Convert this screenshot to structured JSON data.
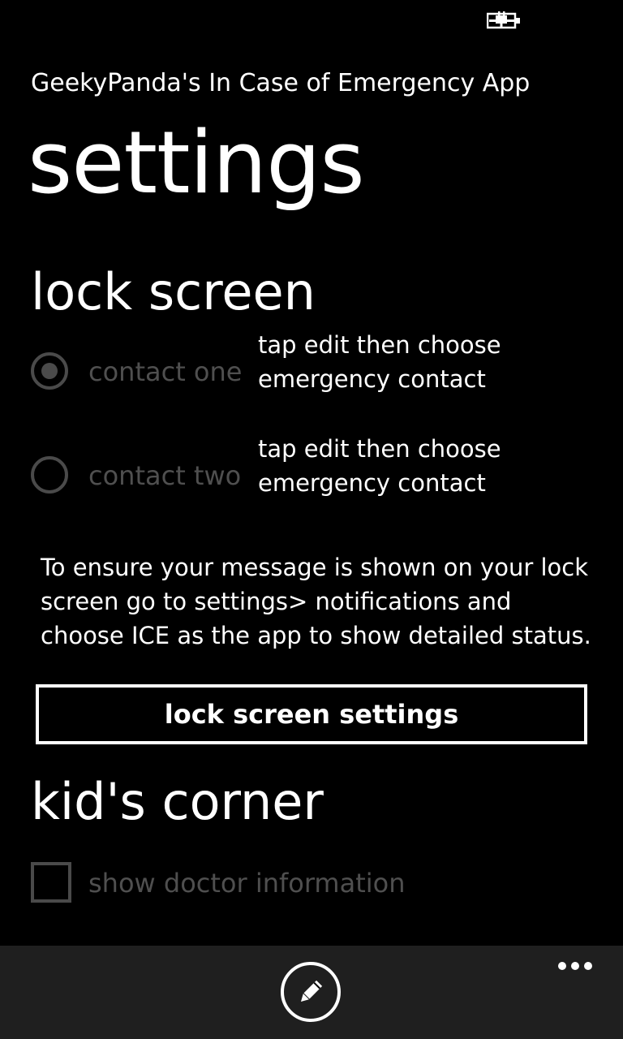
{
  "status_bar": {
    "battery_icon": "battery-charging-icon"
  },
  "header": {
    "app_title": "GeekyPanda's In Case of Emergency App",
    "page_title": "settings"
  },
  "lock_screen": {
    "title": "lock screen",
    "contacts": [
      {
        "label": "contact one",
        "value": "tap edit then choose emergency contact",
        "selected": true
      },
      {
        "label": "contact two",
        "value": "tap edit then choose emergency contact",
        "selected": false
      }
    ],
    "info_text": "To ensure your message is shown on your lock screen go to settings> notifications and choose ICE as the app to show detailed status.",
    "settings_button": "lock screen settings"
  },
  "kids_corner": {
    "title": "kid's corner",
    "show_doctor_label": "show doctor information",
    "show_doctor_checked": false
  },
  "app_bar": {
    "edit_icon": "pencil-edit-icon",
    "more_icon": "ellipsis-more-icon",
    "background": "#1f1f1f"
  },
  "colors": {
    "disabled": "#4a4a4a",
    "foreground": "#ffffff",
    "background": "#000000"
  }
}
